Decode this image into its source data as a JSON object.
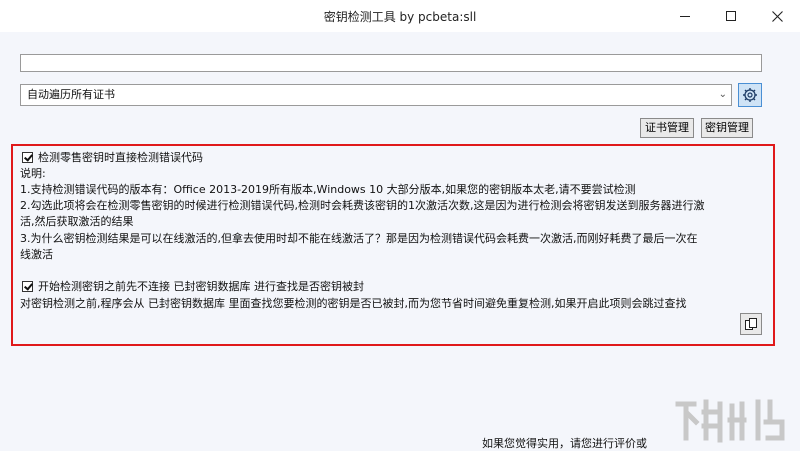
{
  "window": {
    "title": "密钥检测工具 by pcbeta:sll"
  },
  "top_input": {
    "value": "",
    "placeholder": ""
  },
  "cert_select": {
    "selected": "自动遍历所有证书"
  },
  "buttons": {
    "cert_manage": "证书管理",
    "key_manage": "密钥管理"
  },
  "panel": {
    "option1_label": "检测零售密钥时直接检测错误代码",
    "desc_title": "说明:",
    "desc_line1": "1.支持检测错误代码的版本有：Office 2013-2019所有版本,Windows 10 大部分版本,如果您的密钥版本太老,请不要尝试检测",
    "desc_line2a": "2.勾选此项将会在检测零售密钥的时候进行检测错误代码,检测时会耗费该密钥的1次激活次数,这是因为进行检测会将密钥发送到服务器进行激",
    "desc_line2b": "活,然后获取激活的结果",
    "desc_line3a": "3.为什么密钥检测结果是可以在线激活的,但拿去使用时却不能在线激活了？那是因为检测错误代码会耗费一次激活,而刚好耗费了最后一次在",
    "desc_line3b": "线激活",
    "option2_label": "开始检测密钥之前先不连接 已封密钥数据库 进行查找是否密钥被封",
    "option2_desc": "对密钥检测之前,程序会从 已封密钥数据库 里面查找您要检测的密钥是否已被封,而为您节省时间避免重复检测,如果开启此项则会跳过查找"
  },
  "footer": {
    "text": "如果您觉得实用，请您进行评价或"
  },
  "icons": {
    "settings": "gear-icon",
    "copy": "copy-icon",
    "dropdown": "chevron-down-icon"
  },
  "colors": {
    "highlight_border": "#e0191a",
    "settings_button_bg": "#cfe3f6"
  }
}
